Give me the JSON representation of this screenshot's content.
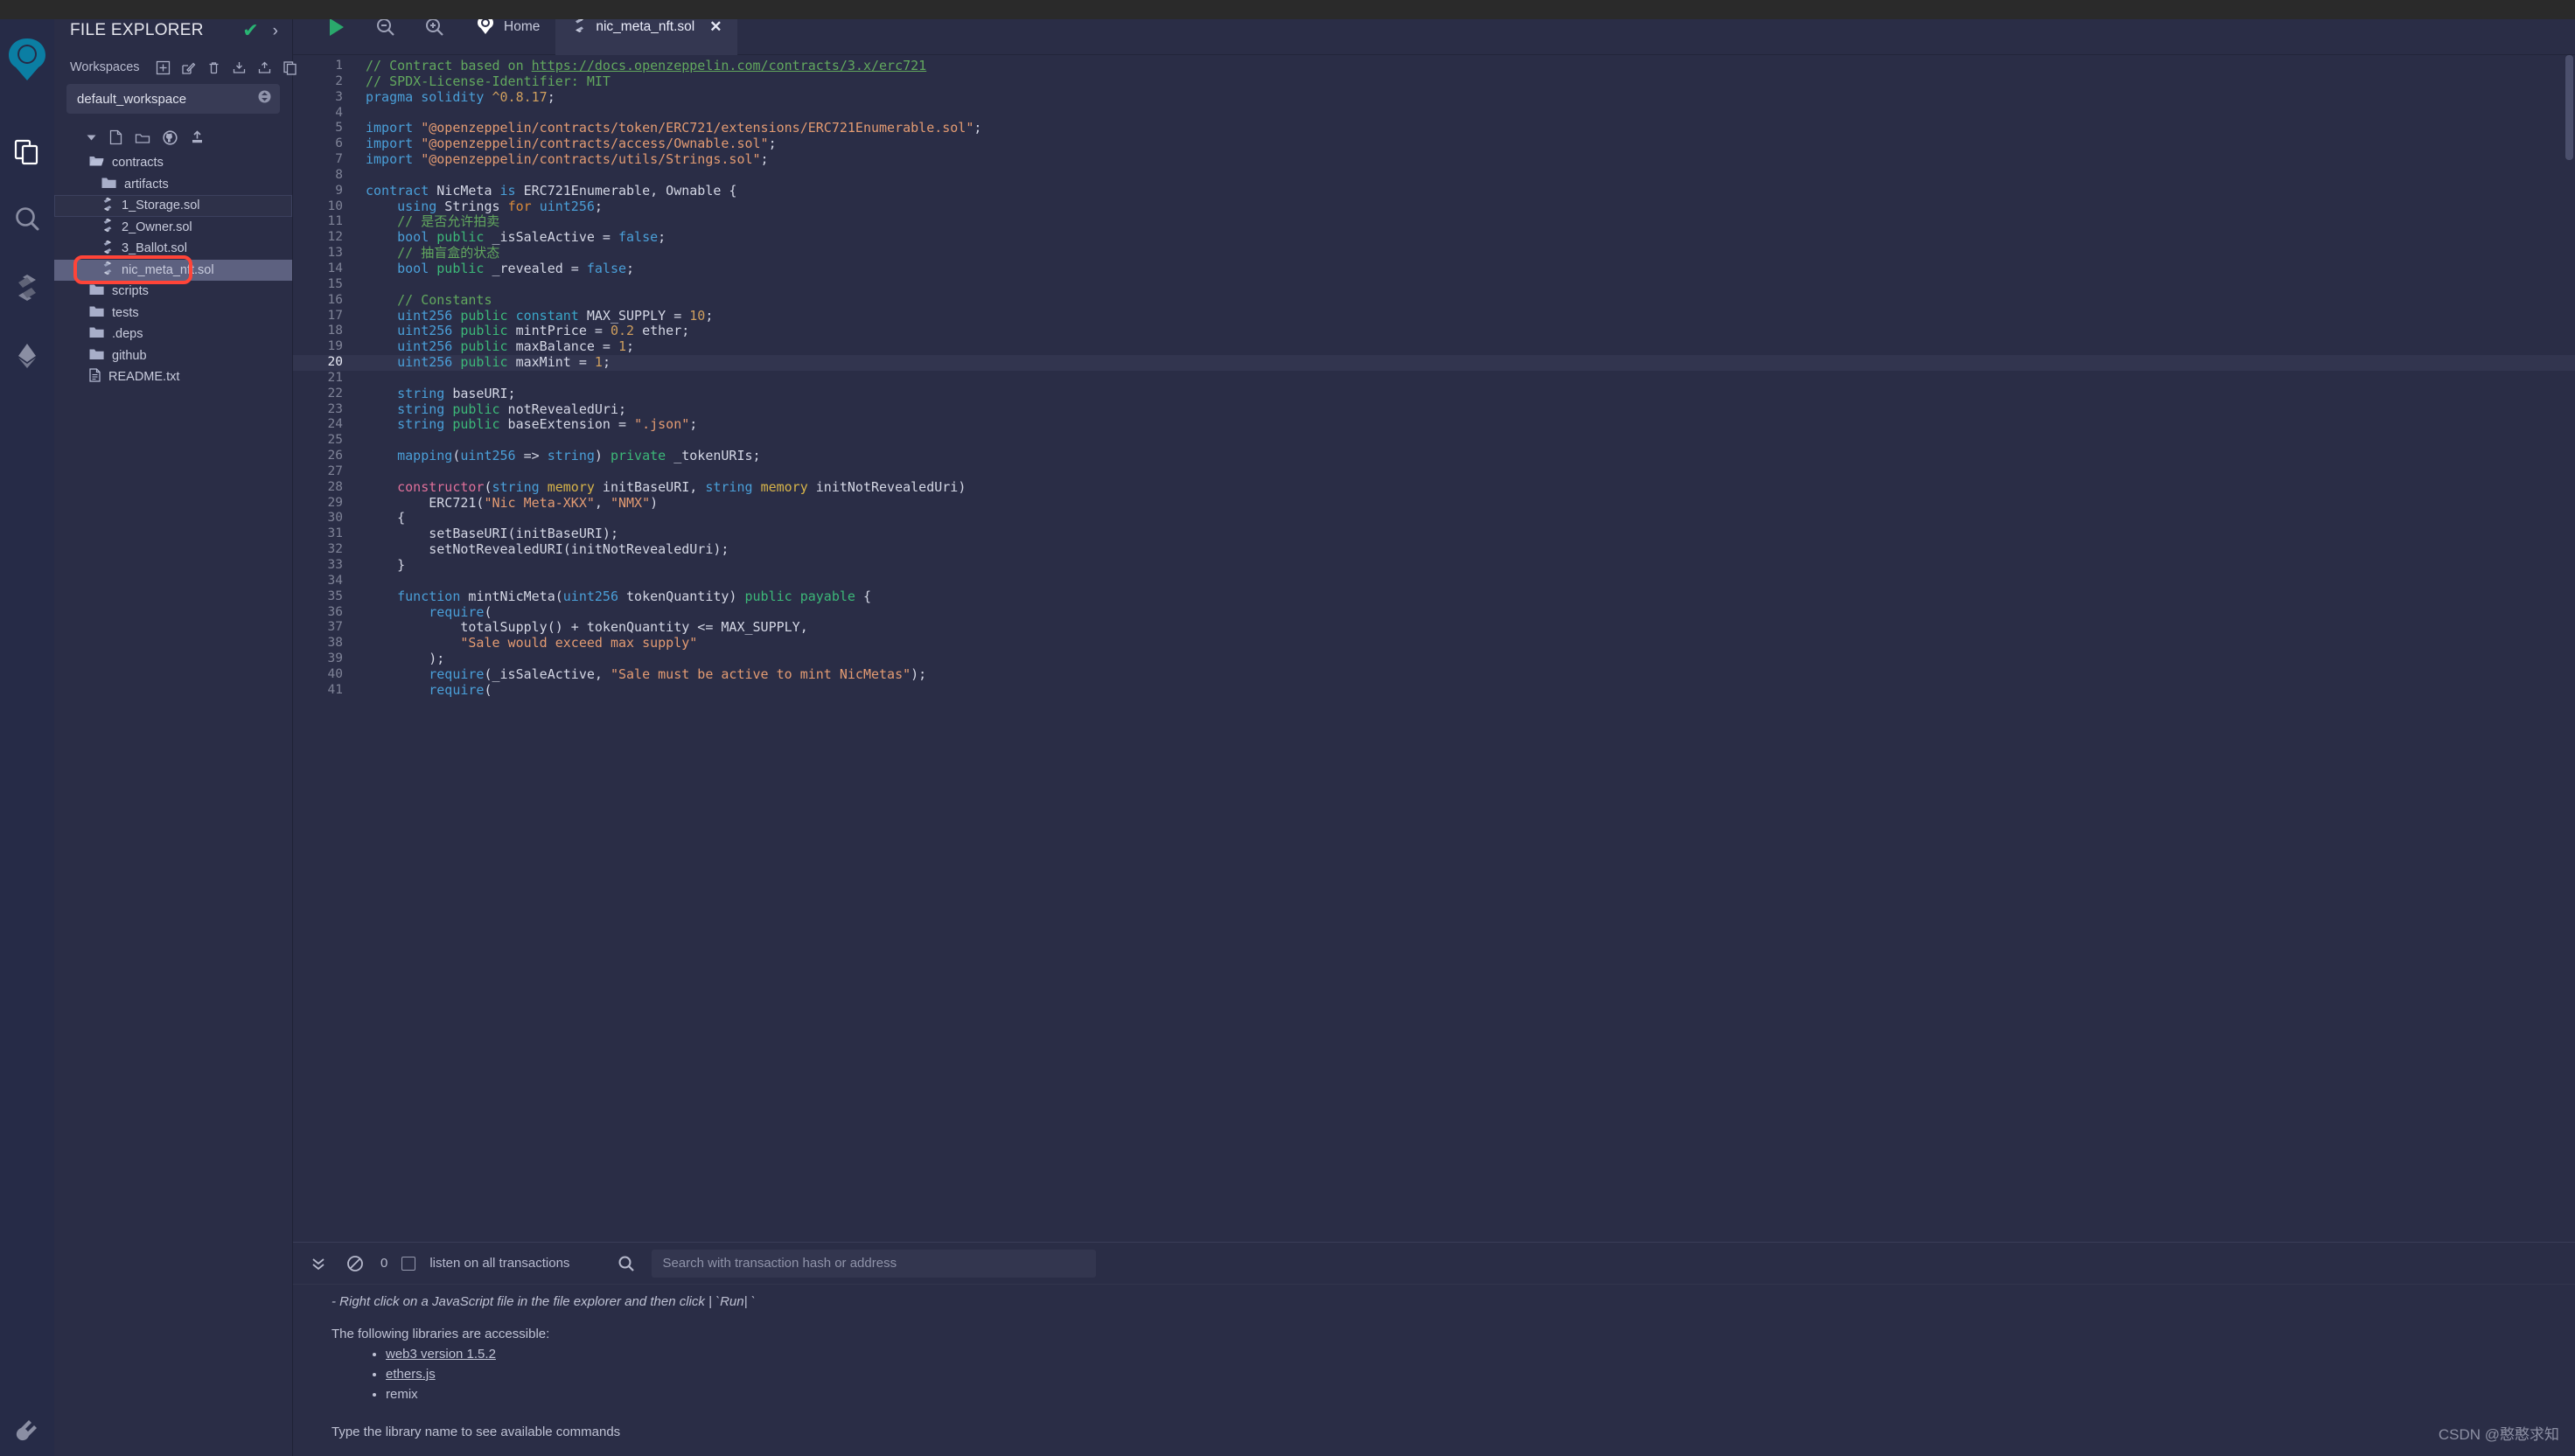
{
  "app": {
    "name": "Remix IDE",
    "watermark": "CSDN @憨憨求知"
  },
  "rail": {
    "items": [
      {
        "name": "remix-logo",
        "label": "Remix"
      },
      {
        "name": "file-explorer",
        "label": "File explorer"
      },
      {
        "name": "search",
        "label": "Search in files"
      },
      {
        "name": "solidity-compiler",
        "label": "Solidity compiler"
      },
      {
        "name": "deploy-run",
        "label": "Deploy & run transactions"
      }
    ],
    "bottom": {
      "name": "plugin-manager",
      "label": "Plugin manager"
    }
  },
  "explorer": {
    "title": "FILE EXPLORER",
    "header_icons": {
      "check": "✔",
      "chevron": "›"
    },
    "workspaces_label": "Workspaces",
    "workspace_actions": [
      "create-workspace",
      "rename-workspace",
      "delete-workspace",
      "download-workspaces",
      "restore-workspaces",
      "clone-workspace"
    ],
    "workspace_selected": "default_workspace",
    "tree_tools": [
      "collapse-toggle",
      "new-file",
      "new-folder",
      "github-clone",
      "publish-to-gist"
    ],
    "tree": [
      {
        "label": "contracts",
        "type": "folder-open",
        "depth": 0,
        "state": "normal"
      },
      {
        "label": "artifacts",
        "type": "folder",
        "depth": 1,
        "state": "normal"
      },
      {
        "label": "1_Storage.sol",
        "type": "sol",
        "depth": 1,
        "state": "outlined"
      },
      {
        "label": "2_Owner.sol",
        "type": "sol",
        "depth": 1,
        "state": "normal"
      },
      {
        "label": "3_Ballot.sol",
        "type": "sol",
        "depth": 1,
        "state": "normal"
      },
      {
        "label": "nic_meta_nft.sol",
        "type": "sol",
        "depth": 1,
        "state": "selected"
      },
      {
        "label": "scripts",
        "type": "folder",
        "depth": 0,
        "state": "normal"
      },
      {
        "label": "tests",
        "type": "folder",
        "depth": 0,
        "state": "normal"
      },
      {
        "label": ".deps",
        "type": "folder",
        "depth": 0,
        "state": "normal"
      },
      {
        "label": "github",
        "type": "folder",
        "depth": 0,
        "state": "normal"
      },
      {
        "label": "README.txt",
        "type": "txt",
        "depth": 0,
        "state": "normal"
      }
    ]
  },
  "tabbar": {
    "run_label": "run-script",
    "zoom_out_label": "zoom-out",
    "zoom_in_label": "zoom-in",
    "tabs": [
      {
        "label": "Home",
        "icon": "remix-logo",
        "active": false,
        "closable": false
      },
      {
        "label": "nic_meta_nft.sol",
        "icon": "sol",
        "active": true,
        "closable": true,
        "close": "✕"
      }
    ]
  },
  "editor": {
    "active_line": 20,
    "lines": [
      {
        "n": 1,
        "tokens": [
          {
            "t": "// Contract based on ",
            "c": "com"
          },
          {
            "t": "https://docs.openzeppelin.com/contracts/3.x/erc721",
            "c": "link"
          }
        ]
      },
      {
        "n": 2,
        "tokens": [
          {
            "t": "// SPDX-License-Identifier: MIT",
            "c": "com"
          }
        ]
      },
      {
        "n": 3,
        "tokens": [
          {
            "t": "pragma",
            "c": "kw"
          },
          {
            "t": " ",
            "c": "plain"
          },
          {
            "t": "solidity",
            "c": "kw"
          },
          {
            "t": " ",
            "c": "plain"
          },
          {
            "t": "^0.8.17",
            "c": "num"
          },
          {
            "t": ";",
            "c": "plain"
          }
        ]
      },
      {
        "n": 4,
        "tokens": []
      },
      {
        "n": 5,
        "tokens": [
          {
            "t": "import",
            "c": "kw"
          },
          {
            "t": " ",
            "c": "plain"
          },
          {
            "t": "\"@openzeppelin/contracts/token/ERC721/extensions/ERC721Enumerable.sol\"",
            "c": "str"
          },
          {
            "t": ";",
            "c": "plain"
          }
        ]
      },
      {
        "n": 6,
        "tokens": [
          {
            "t": "import",
            "c": "kw"
          },
          {
            "t": " ",
            "c": "plain"
          },
          {
            "t": "\"@openzeppelin/contracts/access/Ownable.sol\"",
            "c": "str"
          },
          {
            "t": ";",
            "c": "plain"
          }
        ]
      },
      {
        "n": 7,
        "tokens": [
          {
            "t": "import",
            "c": "kw"
          },
          {
            "t": " ",
            "c": "plain"
          },
          {
            "t": "\"@openzeppelin/contracts/utils/Strings.sol\"",
            "c": "str"
          },
          {
            "t": ";",
            "c": "plain"
          }
        ]
      },
      {
        "n": 8,
        "tokens": []
      },
      {
        "n": 9,
        "tokens": [
          {
            "t": "contract",
            "c": "kw"
          },
          {
            "t": " NicMeta ",
            "c": "plain"
          },
          {
            "t": "is",
            "c": "kw"
          },
          {
            "t": " ERC721Enumerable, Ownable {",
            "c": "plain"
          }
        ]
      },
      {
        "n": 10,
        "tokens": [
          {
            "t": "    ",
            "c": "plain"
          },
          {
            "t": "using",
            "c": "kw"
          },
          {
            "t": " Strings ",
            "c": "plain"
          },
          {
            "t": "for",
            "c": "for"
          },
          {
            "t": " ",
            "c": "plain"
          },
          {
            "t": "uint256",
            "c": "type"
          },
          {
            "t": ";",
            "c": "plain"
          }
        ]
      },
      {
        "n": 11,
        "tokens": [
          {
            "t": "    // 是否允许拍卖",
            "c": "com"
          }
        ]
      },
      {
        "n": 12,
        "tokens": [
          {
            "t": "    ",
            "c": "plain"
          },
          {
            "t": "bool",
            "c": "type"
          },
          {
            "t": " ",
            "c": "plain"
          },
          {
            "t": "public",
            "c": "pub"
          },
          {
            "t": " _isSaleActive = ",
            "c": "plain"
          },
          {
            "t": "false",
            "c": "kw"
          },
          {
            "t": ";",
            "c": "plain"
          }
        ]
      },
      {
        "n": 13,
        "tokens": [
          {
            "t": "    // 抽盲盒的状态",
            "c": "com"
          }
        ]
      },
      {
        "n": 14,
        "tokens": [
          {
            "t": "    ",
            "c": "plain"
          },
          {
            "t": "bool",
            "c": "type"
          },
          {
            "t": " ",
            "c": "plain"
          },
          {
            "t": "public",
            "c": "pub"
          },
          {
            "t": " _revealed = ",
            "c": "plain"
          },
          {
            "t": "false",
            "c": "kw"
          },
          {
            "t": ";",
            "c": "plain"
          }
        ]
      },
      {
        "n": 15,
        "tokens": []
      },
      {
        "n": 16,
        "tokens": [
          {
            "t": "    // Constants",
            "c": "com"
          }
        ]
      },
      {
        "n": 17,
        "tokens": [
          {
            "t": "    ",
            "c": "plain"
          },
          {
            "t": "uint256",
            "c": "type"
          },
          {
            "t": " ",
            "c": "plain"
          },
          {
            "t": "public",
            "c": "pub"
          },
          {
            "t": " ",
            "c": "plain"
          },
          {
            "t": "constant",
            "c": "kw2"
          },
          {
            "t": " MAX_SUPPLY = ",
            "c": "plain"
          },
          {
            "t": "10",
            "c": "num"
          },
          {
            "t": ";",
            "c": "plain"
          }
        ]
      },
      {
        "n": 18,
        "tokens": [
          {
            "t": "    ",
            "c": "plain"
          },
          {
            "t": "uint256",
            "c": "type"
          },
          {
            "t": " ",
            "c": "plain"
          },
          {
            "t": "public",
            "c": "pub"
          },
          {
            "t": " mintPrice = ",
            "c": "plain"
          },
          {
            "t": "0.2",
            "c": "num"
          },
          {
            "t": " ether;",
            "c": "plain"
          }
        ]
      },
      {
        "n": 19,
        "tokens": [
          {
            "t": "    ",
            "c": "plain"
          },
          {
            "t": "uint256",
            "c": "type"
          },
          {
            "t": " ",
            "c": "plain"
          },
          {
            "t": "public",
            "c": "pub"
          },
          {
            "t": " maxBalance = ",
            "c": "plain"
          },
          {
            "t": "1",
            "c": "num"
          },
          {
            "t": ";",
            "c": "plain"
          }
        ]
      },
      {
        "n": 20,
        "tokens": [
          {
            "t": "    ",
            "c": "plain"
          },
          {
            "t": "uint256",
            "c": "type"
          },
          {
            "t": " ",
            "c": "plain"
          },
          {
            "t": "public",
            "c": "pub"
          },
          {
            "t": " maxMint = ",
            "c": "plain"
          },
          {
            "t": "1",
            "c": "num"
          },
          {
            "t": ";",
            "c": "plain"
          }
        ]
      },
      {
        "n": 21,
        "tokens": []
      },
      {
        "n": 22,
        "tokens": [
          {
            "t": "    ",
            "c": "plain"
          },
          {
            "t": "string",
            "c": "type"
          },
          {
            "t": " baseURI;",
            "c": "plain"
          }
        ]
      },
      {
        "n": 23,
        "tokens": [
          {
            "t": "    ",
            "c": "plain"
          },
          {
            "t": "string",
            "c": "type"
          },
          {
            "t": " ",
            "c": "plain"
          },
          {
            "t": "public",
            "c": "pub"
          },
          {
            "t": " notRevealedUri;",
            "c": "plain"
          }
        ]
      },
      {
        "n": 24,
        "tokens": [
          {
            "t": "    ",
            "c": "plain"
          },
          {
            "t": "string",
            "c": "type"
          },
          {
            "t": " ",
            "c": "plain"
          },
          {
            "t": "public",
            "c": "pub"
          },
          {
            "t": " baseExtension = ",
            "c": "plain"
          },
          {
            "t": "\".json\"",
            "c": "str"
          },
          {
            "t": ";",
            "c": "plain"
          }
        ]
      },
      {
        "n": 25,
        "tokens": []
      },
      {
        "n": 26,
        "tokens": [
          {
            "t": "    ",
            "c": "plain"
          },
          {
            "t": "mapping",
            "c": "type"
          },
          {
            "t": "(",
            "c": "plain"
          },
          {
            "t": "uint256",
            "c": "type"
          },
          {
            "t": " => ",
            "c": "plain"
          },
          {
            "t": "string",
            "c": "type"
          },
          {
            "t": ") ",
            "c": "plain"
          },
          {
            "t": "private",
            "c": "pub"
          },
          {
            "t": " _tokenURIs;",
            "c": "plain"
          }
        ]
      },
      {
        "n": 27,
        "tokens": []
      },
      {
        "n": 28,
        "tokens": [
          {
            "t": "    ",
            "c": "plain"
          },
          {
            "t": "constructor",
            "c": "ctor"
          },
          {
            "t": "(",
            "c": "plain"
          },
          {
            "t": "string",
            "c": "type"
          },
          {
            "t": " ",
            "c": "plain"
          },
          {
            "t": "memory",
            "c": "mem"
          },
          {
            "t": " initBaseURI, ",
            "c": "plain"
          },
          {
            "t": "string",
            "c": "type"
          },
          {
            "t": " ",
            "c": "plain"
          },
          {
            "t": "memory",
            "c": "mem"
          },
          {
            "t": " initNotRevealedUri)",
            "c": "plain"
          }
        ]
      },
      {
        "n": 29,
        "tokens": [
          {
            "t": "        ERC721(",
            "c": "plain"
          },
          {
            "t": "\"Nic Meta-XKX\"",
            "c": "str"
          },
          {
            "t": ", ",
            "c": "plain"
          },
          {
            "t": "\"NMX\"",
            "c": "str"
          },
          {
            "t": ")",
            "c": "plain"
          }
        ]
      },
      {
        "n": 30,
        "tokens": [
          {
            "t": "    {",
            "c": "plain"
          }
        ]
      },
      {
        "n": 31,
        "tokens": [
          {
            "t": "        setBaseURI(initBaseURI);",
            "c": "plain"
          }
        ]
      },
      {
        "n": 32,
        "tokens": [
          {
            "t": "        setNotRevealedURI(initNotRevealedUri);",
            "c": "plain"
          }
        ]
      },
      {
        "n": 33,
        "tokens": [
          {
            "t": "    }",
            "c": "plain"
          }
        ]
      },
      {
        "n": 34,
        "tokens": []
      },
      {
        "n": 35,
        "tokens": [
          {
            "t": "    ",
            "c": "plain"
          },
          {
            "t": "function",
            "c": "kw"
          },
          {
            "t": " mintNicMeta(",
            "c": "plain"
          },
          {
            "t": "uint256",
            "c": "type"
          },
          {
            "t": " tokenQuantity) ",
            "c": "plain"
          },
          {
            "t": "public",
            "c": "pub"
          },
          {
            "t": " ",
            "c": "plain"
          },
          {
            "t": "payable",
            "c": "pub"
          },
          {
            "t": " {",
            "c": "plain"
          }
        ]
      },
      {
        "n": 36,
        "tokens": [
          {
            "t": "        ",
            "c": "plain"
          },
          {
            "t": "require",
            "c": "fn"
          },
          {
            "t": "(",
            "c": "plain"
          }
        ]
      },
      {
        "n": 37,
        "tokens": [
          {
            "t": "            totalSupply() + tokenQuantity <= MAX_SUPPLY,",
            "c": "plain"
          }
        ]
      },
      {
        "n": 38,
        "tokens": [
          {
            "t": "            ",
            "c": "plain"
          },
          {
            "t": "\"Sale would exceed max supply\"",
            "c": "str"
          }
        ]
      },
      {
        "n": 39,
        "tokens": [
          {
            "t": "        );",
            "c": "plain"
          }
        ]
      },
      {
        "n": 40,
        "tokens": [
          {
            "t": "        ",
            "c": "plain"
          },
          {
            "t": "require",
            "c": "fn"
          },
          {
            "t": "(_isSaleActive, ",
            "c": "plain"
          },
          {
            "t": "\"Sale must be active to mint NicMetas\"",
            "c": "str"
          },
          {
            "t": ");",
            "c": "plain"
          }
        ]
      },
      {
        "n": 41,
        "tokens": [
          {
            "t": "        ",
            "c": "plain"
          },
          {
            "t": "require",
            "c": "fn"
          },
          {
            "t": "(",
            "c": "plain"
          }
        ]
      }
    ]
  },
  "terminal": {
    "collapse_icon": "chevrons-down-icon",
    "clear_icon": "no-entry-icon",
    "count": "0",
    "listen_label": "listen on all transactions",
    "listen_checked": false,
    "search_icon": "search-icon",
    "search_placeholder": "Search with transaction hash or address",
    "lines": [
      {
        "kind": "italic",
        "text": "- Right click on a JavaScript file in the file explorer and then click | `Run| `"
      },
      {
        "kind": "blank",
        "text": ""
      },
      {
        "kind": "text",
        "text": "The following libraries are accessible:"
      }
    ],
    "libraries": [
      {
        "label": "web3 version 1.5.2",
        "link": true
      },
      {
        "label": "ethers.js",
        "link": true
      },
      {
        "label": "remix",
        "link": false
      }
    ],
    "footer_hint": "Type the library name to see available commands"
  }
}
